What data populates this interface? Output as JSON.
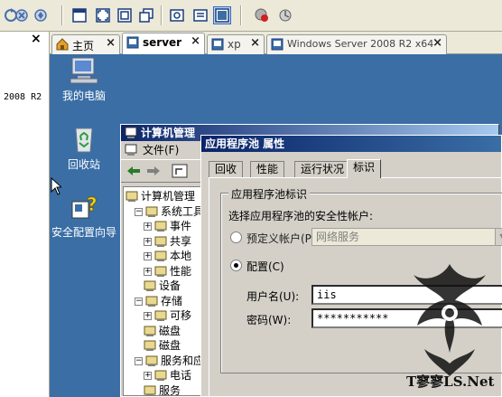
{
  "toolbar": {
    "buttons": [
      "refresh-icon",
      "stop-icon",
      "settings-icon",
      "fit-icon",
      "fullscreen-icon",
      "window-icon",
      "copy-icon",
      "send-keys-icon",
      "clipboard-icon",
      "view-icon",
      "record-icon",
      "snapshot-icon"
    ]
  },
  "left_pane": {
    "close": "×",
    "text": "2008 R2"
  },
  "tabs": [
    {
      "label": "主页",
      "icon": "home-icon",
      "active": false
    },
    {
      "label": "server",
      "icon": "vm-icon",
      "active": true
    },
    {
      "label": "xp",
      "icon": "vm-icon",
      "active": false
    },
    {
      "label": "Windows Server 2008 R2 x64",
      "icon": "vm-icon",
      "active": false
    }
  ],
  "tab_close": "×",
  "desktop_icons": [
    {
      "label": "我的电脑",
      "icon": "my-computer-icon"
    },
    {
      "label": "回收站",
      "icon": "recycle-bin-icon"
    },
    {
      "label": "安全配置向导",
      "icon": "security-wizard-icon"
    }
  ],
  "cm_window": {
    "title": "计算机管理",
    "menu_file": "文件(F)",
    "tree": [
      {
        "label": "计算机管理",
        "level": 0,
        "expander": ""
      },
      {
        "label": "系统工具",
        "level": 1,
        "expander": "−"
      },
      {
        "label": "事件",
        "level": 2,
        "expander": "+"
      },
      {
        "label": "共享",
        "level": 2,
        "expander": "+"
      },
      {
        "label": "本地",
        "level": 2,
        "expander": "+"
      },
      {
        "label": "性能",
        "level": 2,
        "expander": "+"
      },
      {
        "label": "设备",
        "level": 2,
        "expander": ""
      },
      {
        "label": "存储",
        "level": 1,
        "expander": "−"
      },
      {
        "label": "可移",
        "level": 2,
        "expander": "+"
      },
      {
        "label": "磁盘",
        "level": 2,
        "expander": ""
      },
      {
        "label": "磁盘",
        "level": 2,
        "expander": ""
      },
      {
        "label": "服务和应",
        "level": 1,
        "expander": "−"
      },
      {
        "label": "电话",
        "level": 2,
        "expander": "+"
      },
      {
        "label": "服务",
        "level": 2,
        "expander": ""
      }
    ]
  },
  "dialog": {
    "title": "应用程序池 属性",
    "tabs": [
      "回收",
      "性能",
      "运行状况",
      "标识"
    ],
    "active_tab": "标识",
    "group_title": "应用程序池标识",
    "prompt": "选择应用程序池的安全性帐户:",
    "predefined_label": "预定义帐户(P)",
    "predefined_value": "网络服务",
    "configurable_label": "配置(C)",
    "username_label": "用户名(U):",
    "username_value": "iis",
    "password_label": "密码(W):",
    "password_value": "***********"
  },
  "watermark_text": "T寥寥LS.Net"
}
